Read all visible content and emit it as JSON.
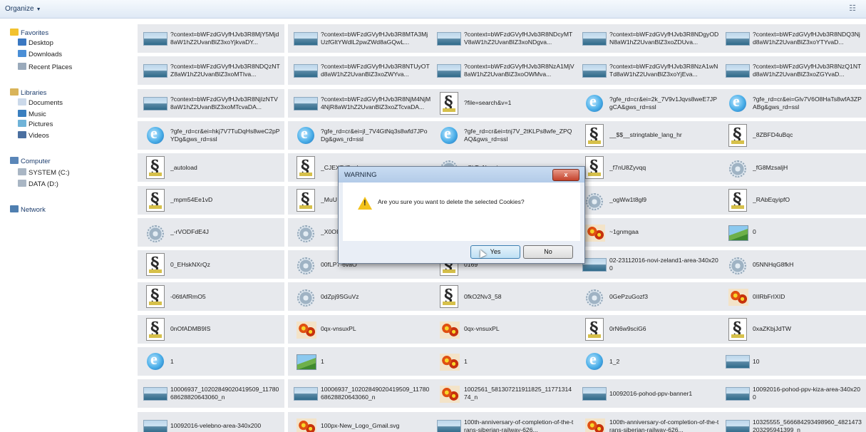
{
  "toolbar": {
    "organize_label": "Organize",
    "view_icon": "view-options-icon"
  },
  "nav": {
    "items": [
      {
        "label": "Favorites",
        "icon": "star-icon",
        "kind": "grp"
      },
      {
        "label": "Desktop",
        "icon": "desktop-icon",
        "kind": "sub"
      },
      {
        "label": "Downloads",
        "icon": "downloads-icon",
        "kind": "sub"
      },
      {
        "label": "Recent Places",
        "icon": "recent-places-icon",
        "kind": "sub"
      },
      {
        "label": "Libraries",
        "icon": "libraries-icon",
        "kind": "grp"
      },
      {
        "label": "Documents",
        "icon": "documents-icon",
        "kind": "sub"
      },
      {
        "label": "Music",
        "icon": "music-icon",
        "kind": "sub"
      },
      {
        "label": "Pictures",
        "icon": "pictures-icon",
        "kind": "sub"
      },
      {
        "label": "Videos",
        "icon": "videos-icon",
        "kind": "sub"
      },
      {
        "label": "Computer",
        "icon": "computer-icon",
        "kind": "grp"
      },
      {
        "label": "SYSTEM (C:)",
        "icon": "drive-icon",
        "kind": "sub"
      },
      {
        "label": "DATA (D:)",
        "icon": "drive-icon",
        "kind": "sub"
      },
      {
        "label": "Network",
        "icon": "network-icon",
        "kind": "grp"
      }
    ]
  },
  "files": [
    {
      "name": "?context=bWFzdGVyfHJvb3R8MjY5Mjd8aW1hZ2UvanBlZ3xoYjkvaDY...",
      "icon": "img"
    },
    {
      "name": "?context=bWFzdGVyfHJvb3R8MTA3MjUzfGltYWdlL2pwZWd8aGQwL...",
      "icon": "img"
    },
    {
      "name": "?context=bWFzdGVyfHJvb3R8NDcyMTV8aW1hZ2UvanBlZ3xoNDgva...",
      "icon": "img"
    },
    {
      "name": "?context=bWFzdGVyfHJvb3R8NDgyODN8aW1hZ2UvanBlZ3xoZDUva...",
      "icon": "img"
    },
    {
      "name": "?context=bWFzdGVyfHJvb3R8NDQ3Njd8aW1hZ2UvanBlZ3xoYTYvaD...",
      "icon": "img"
    },
    {
      "name": "?context=bWFzdGVyfHJvb3R8NDQzNTZ8aW1hZ2UvanBlZ3xoMTIva...",
      "icon": "img"
    },
    {
      "name": "?context=bWFzdGVyfHJvb3R8NTUyOTd8aW1hZ2UvanBlZ3xoZWYva...",
      "icon": "img"
    },
    {
      "name": "?context=bWFzdGVyfHJvb3R8NzA1MjV8aW1hZ2UvanBlZ3xoOWMva...",
      "icon": "img"
    },
    {
      "name": "?context=bWFzdGVyfHJvb3R8NzA1wNTd8aW1hZ2UvanBlZ3xoYjEva...",
      "icon": "img"
    },
    {
      "name": "?context=bWFzdGVyfHJvb3R8NzQ1NTd8aW1hZ2UvanBlZ3xoZGYvaD...",
      "icon": "img"
    },
    {
      "name": "?context=bWFzdGVyfHJvb3R8NjIzNTV8aW1hZ2UvanBlZ3xoMTcvaDA...",
      "icon": "img"
    },
    {
      "name": "?context=bWFzdGVyfHJvb3R8NjM4NjM4NjR8aW1hZ2UvanBlZ3xoZTcvaDA...",
      "icon": "img"
    },
    {
      "name": "?file=search&v=1",
      "icon": "script"
    },
    {
      "name": "?gfe_rd=cr&ei=2k_7V9v1Jqvs8weE7JPgCA&gws_rd=ssl",
      "icon": "ie"
    },
    {
      "name": "?gfe_rd=cr&ei=Glv7V6O8HaTs8wfA3ZPABg&gws_rd=ssl",
      "icon": "ie"
    },
    {
      "name": "?gfe_rd=cr&ei=hkj7V7TuDqHs8weC2pPYDg&gws_rd=ssl",
      "icon": "ie"
    },
    {
      "name": "?gfe_rd=cr&ei=jl_7V4GtNq3s8wfd7JPoDg&gws_rd=ssl",
      "icon": "ie"
    },
    {
      "name": "?gfe_rd=cr&ei=tnj7V_2tKLPs8wfe_ZPQAQ&gws_rd=ssl",
      "icon": "ie"
    },
    {
      "name": "__$$__stringtable_lang_hr",
      "icon": "script"
    },
    {
      "name": "_8ZBFD4uBqc",
      "icon": "script"
    },
    {
      "name": "_autoload",
      "icon": "script"
    },
    {
      "name": "_CJEXFd5wd",
      "icon": "script"
    },
    {
      "name": "_CkTv1Lwaim",
      "icon": "gear"
    },
    {
      "name": "_f7nU8Zyvqq",
      "icon": "script"
    },
    {
      "name": "_fG8MzsaljH",
      "icon": "gear"
    },
    {
      "name": "_mpm54Ee1vD",
      "icon": "script"
    },
    {
      "name": "_MuU",
      "icon": "script"
    },
    {
      "name": "",
      "icon": "script"
    },
    {
      "name": "_ogWw1t8gl9",
      "icon": "gear"
    },
    {
      "name": "_RAbEqyipfO",
      "icon": "script"
    },
    {
      "name": "_-rVODFdE4J",
      "icon": "gear"
    },
    {
      "name": "_X0OI",
      "icon": "gear"
    },
    {
      "name": "",
      "icon": "script"
    },
    {
      "name": "~1gnmgaa",
      "icon": "flower"
    },
    {
      "name": "0",
      "icon": "pic"
    },
    {
      "name": "0_EHskNXrQz",
      "icon": "script"
    },
    {
      "name": "00fLP7-6vaO",
      "icon": "gear"
    },
    {
      "name": "0169",
      "icon": "script"
    },
    {
      "name": "02-23112016-novi-zeland1-area-340x200",
      "icon": "img"
    },
    {
      "name": "05NNHqG8fkH",
      "icon": "gear"
    },
    {
      "name": "-06tlAfRmO5",
      "icon": "script"
    },
    {
      "name": "0dZpj9SGuVz",
      "icon": "gear"
    },
    {
      "name": "0fkO2Nv3_58",
      "icon": "script"
    },
    {
      "name": "0GePzuGozf3",
      "icon": "gear"
    },
    {
      "name": "0IIRbFrIXID",
      "icon": "flower"
    },
    {
      "name": "0nOfADMB9IS",
      "icon": "script"
    },
    {
      "name": "0qx-vnsuxPL",
      "icon": "flower"
    },
    {
      "name": "0qx-vnsuxPL",
      "icon": "flower"
    },
    {
      "name": "0rN6w9sciG6",
      "icon": "script"
    },
    {
      "name": "0xaZKbjJdTW",
      "icon": "script"
    },
    {
      "name": "1",
      "icon": "ie"
    },
    {
      "name": "1",
      "icon": "pic"
    },
    {
      "name": "1",
      "icon": "flower"
    },
    {
      "name": "1_2",
      "icon": "ie"
    },
    {
      "name": "10",
      "icon": "img"
    },
    {
      "name": "10006937_10202849020419509_1178068628820643060_n",
      "icon": "img"
    },
    {
      "name": "10006937_10202849020419509_1178068628820643060_n",
      "icon": "img"
    },
    {
      "name": "1002561_581307211911825_1177131474_n",
      "icon": "flower"
    },
    {
      "name": "10092016-pohod-ppv-banner1",
      "icon": "img"
    },
    {
      "name": "10092016-pohod-ppv-kiza-area-340x200",
      "icon": "img"
    },
    {
      "name": "10092016-velebno-area-340x200",
      "icon": "img"
    },
    {
      "name": "100px-New_Logo_Gmail.svg",
      "icon": "flower"
    },
    {
      "name": "100th-anniversary-of-completion-of-the-trans-siberian-railway-626...",
      "icon": "img"
    },
    {
      "name": "100th-anniversary-of-completion-of-the-trans-siberian-railway-626...",
      "icon": "flower"
    },
    {
      "name": "10325555_566684293498960_4821473203295941399_n",
      "icon": "img"
    }
  ],
  "dialog": {
    "title": "WARNING",
    "message": "Are you sure you want to delete the selected Cookies?",
    "yes_label": "Yes",
    "no_label": "No",
    "close_label": "x"
  }
}
